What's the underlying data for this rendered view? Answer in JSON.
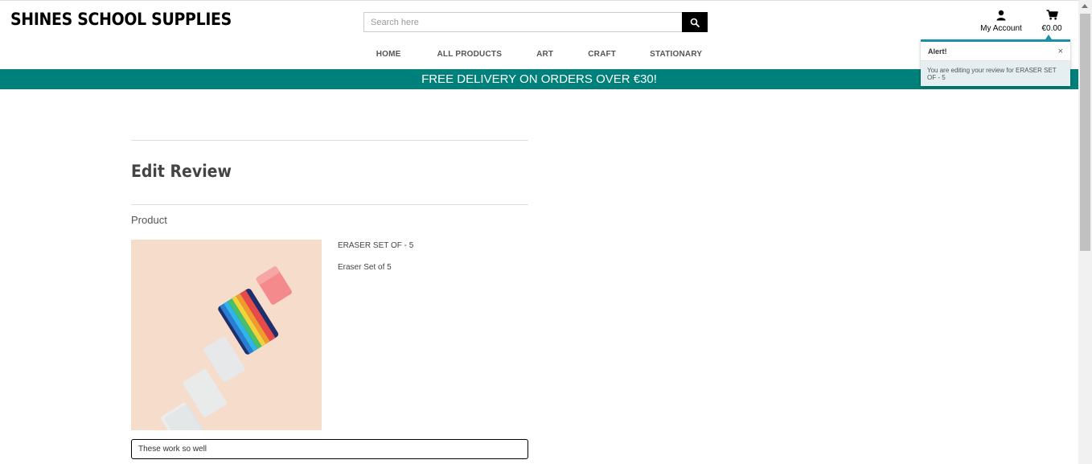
{
  "header": {
    "brand": "SHINES SCHOOL SUPPLIES",
    "search_placeholder": "Search here",
    "account_label": "My Account",
    "cart_total": "€0.00"
  },
  "nav": {
    "items": [
      {
        "label": "HOME"
      },
      {
        "label": "ALL PRODUCTS"
      },
      {
        "label": "ART"
      },
      {
        "label": "CRAFT"
      },
      {
        "label": "STATIONARY"
      }
    ]
  },
  "banner": {
    "text": "FREE DELIVERY ON ORDERS OVER €30!"
  },
  "toast": {
    "title": "Alert!",
    "close": "×",
    "message": "You are editing your review for ERASER SET OF - 5"
  },
  "page": {
    "heading": "Edit Review",
    "product_label": "Product"
  },
  "product": {
    "name": "ERASER SET OF - 5",
    "description": "Eraser Set of 5"
  },
  "review": {
    "value": "These work so well"
  },
  "colors": {
    "banner": "#00807a",
    "toast_accent": "#1e8fa5"
  }
}
